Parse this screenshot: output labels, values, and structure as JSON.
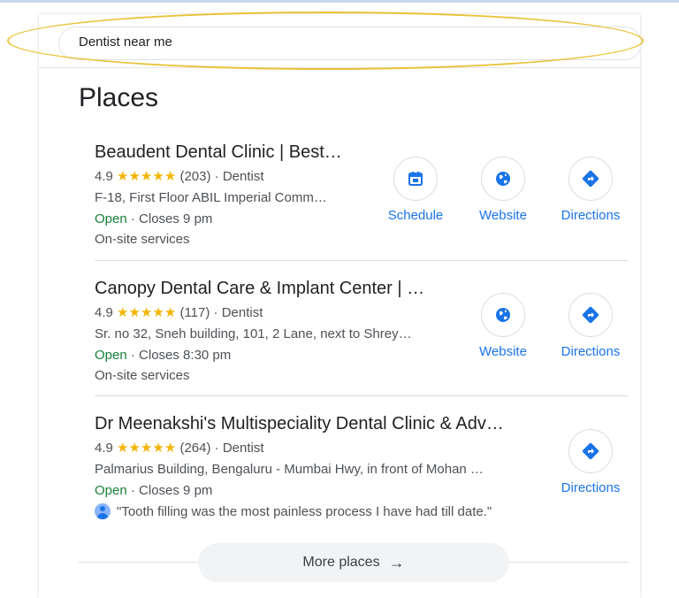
{
  "search": {
    "query": "Dentist near me"
  },
  "places_title": "Places",
  "places": [
    {
      "name": "Beaudent Dental Clinic | Best…",
      "rating": "4.9",
      "stars": "★★★★★",
      "reviews": "(203)",
      "category": "· Dentist",
      "address": "F-18, First Floor ABIL Imperial Comm…",
      "status": "Open",
      "hours": "· Closes 9 pm",
      "extra": "On-site services",
      "actions": {
        "schedule": "Schedule",
        "website": "Website",
        "directions": "Directions"
      }
    },
    {
      "name": "Canopy Dental Care & Implant Center | …",
      "rating": "4.9",
      "stars": "★★★★★",
      "reviews": "(117)",
      "category": "· Dentist",
      "address": "Sr. no 32, Sneh building, 101, 2 Lane, next to Shrey…",
      "status": "Open",
      "hours": "· Closes 8:30 pm",
      "extra": "On-site services",
      "actions": {
        "website": "Website",
        "directions": "Directions"
      }
    },
    {
      "name": "Dr Meenakshi's Multispeciality Dental Clinic & Adv…",
      "rating": "4.9",
      "stars": "★★★★★",
      "reviews": "(264)",
      "category": "· Dentist",
      "address": "Palmarius Building, Bengaluru - Mumbai Hwy, in front of Mohan …",
      "status": "Open",
      "hours": "· Closes 9 pm",
      "review": "\"Tooth filling was the most painless process I have had till date.\"",
      "actions": {
        "directions": "Directions"
      }
    }
  ],
  "more_places": {
    "label": "More places",
    "arrow": "→"
  },
  "colors": {
    "link_blue": "#1a73e8",
    "open_green": "#188038",
    "star_yellow": "#f4b400",
    "highlight": "#e9c237"
  }
}
